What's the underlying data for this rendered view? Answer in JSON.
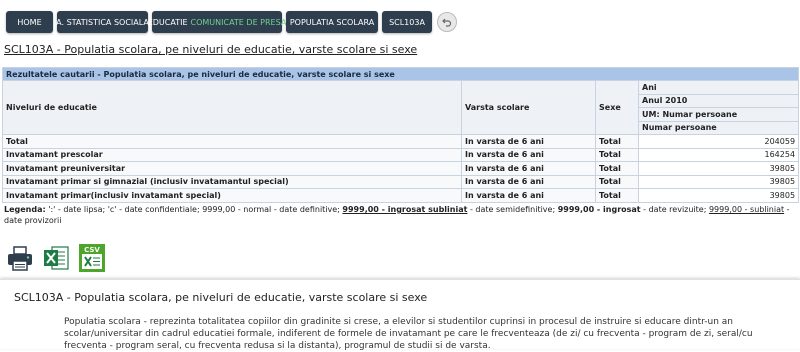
{
  "nav": {
    "home": "HOME",
    "social": "A. STATISTICA SOCIALA",
    "education_prefix": "EDUCATIE",
    "education_highlight": "COMUNICATE DE PRESA",
    "population": "POPULATIA SCOLARA",
    "code": "SCL103A"
  },
  "page_title": "SCL103A - Populatia scolara, pe niveluri de educatie, varste scolare si sexe",
  "table": {
    "header": "Rezultatele cautarii - Populatia scolara, pe niveluri de educatie, varste scolare si sexe",
    "col_levels": "Niveluri de educatie",
    "col_age": "Varsta scolare",
    "col_sex": "Sexe",
    "ani": "Ani",
    "year": "Anul 2010",
    "um": "UM: Numar persoane",
    "unit": "Numar persoane",
    "rows": [
      {
        "level": "Total",
        "age": "In varsta de 6 ani",
        "sex": "Total",
        "value": "204059"
      },
      {
        "level": "Invatamant prescolar",
        "age": "In varsta de 6 ani",
        "sex": "Total",
        "value": "164254"
      },
      {
        "level": "Invatamant preuniversitar",
        "age": "In varsta de 6 ani",
        "sex": "Total",
        "value": "39805"
      },
      {
        "level": "Invatamant primar si gimnazial (inclusiv invatamantul special)",
        "age": "In varsta de 6 ani",
        "sex": "Total",
        "value": "39805"
      },
      {
        "level": "Invatamant primar(inclusiv invatamant special)",
        "age": "In varsta de 6 ani",
        "sex": "Total",
        "value": "39805"
      }
    ]
  },
  "legend": {
    "label": "Legenda:",
    "t1": " ':' - date lipsa; 'c' - date confidentiale; 9999,00 - normal - date definitive; ",
    "b1": "9999,00 - ingrosat subliniat",
    "t2": " - date semidefinitive; ",
    "b2": "9999,00 - ingrosat",
    "t3": " - date revizuite; ",
    "u1": "9999,00 - subliniat",
    "t4": " - date provizorii"
  },
  "exports": {
    "csv_label": "CSV"
  },
  "description": {
    "title": "SCL103A - Populatia scolara, pe niveluri de educatie, varste scolare si sexe",
    "text": "Populatia scolara - reprezinta totalitatea copiilor din gradinite si crese, a elevilor si studentilor cuprinsi in procesul de instruire si educare dintr-un an scolar/universitar din cadrul educatiei formale, indiferent de formele de invatamant pe care le frecventeaza (de zi/ cu frecventa - program de zi, seral/cu frecventa - program seral, cu frecventa redusa si la distanta), programul de studii si de varsta."
  },
  "colors": {
    "nav_bg": "#2f3e4e",
    "nav_highlight": "#6fd38f",
    "table_header_bg": "#a9c4e6",
    "excel_green": "#1e7b45",
    "csv_green": "#4ea52c"
  }
}
